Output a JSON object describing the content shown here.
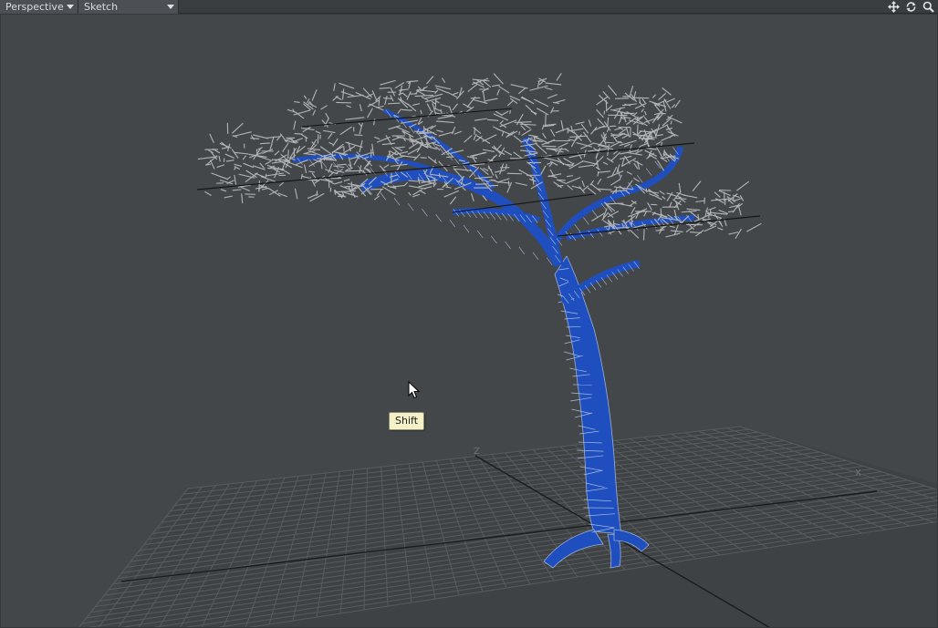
{
  "toolbar": {
    "view_mode": "Perspective",
    "render_style": "Sketch",
    "icons": [
      "move-view-icon",
      "rotate-view-icon",
      "zoom-view-icon"
    ]
  },
  "viewport": {
    "tooltip": "Shift",
    "axis_x": "X",
    "axis_z": "Z"
  },
  "colors": {
    "viewport_bg": "#444749",
    "toolbar_bg": "#3a3d40",
    "trunk_fill": "#1f4fbf",
    "wire": "#b5b8ba",
    "grid": "#5a5e61",
    "tooltip_bg": "#f4f1c8"
  }
}
